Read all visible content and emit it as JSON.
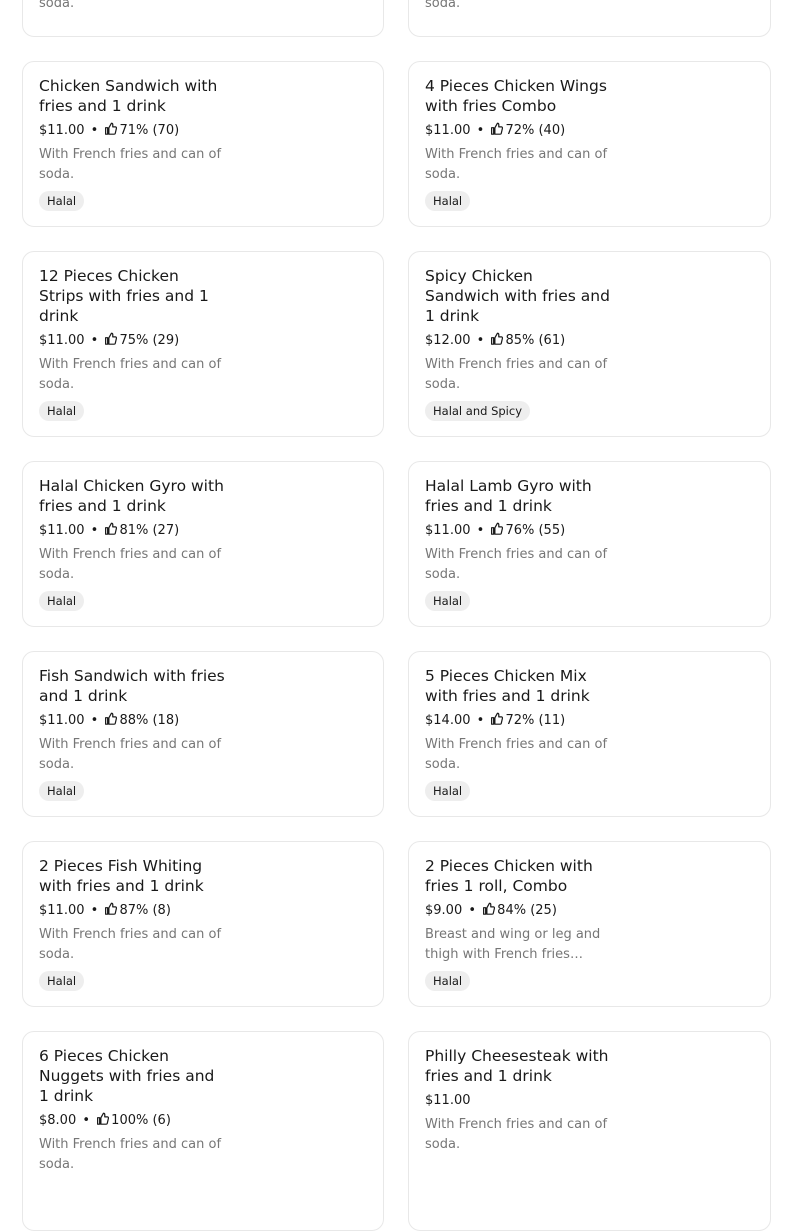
{
  "top_partial": {
    "left": {
      "description": "soda."
    },
    "right": {
      "description": "soda."
    }
  },
  "items": [
    {
      "title": "Chicken Sandwich with fries and 1 drink",
      "price": "$11.00",
      "rating": "71% (70)",
      "description": "With French fries and can of soda.",
      "badge": "Halal"
    },
    {
      "title": "4 Pieces Chicken Wings with fries Combo",
      "price": "$11.00",
      "rating": "72% (40)",
      "description": "With French fries and can of soda.",
      "badge": "Halal"
    },
    {
      "title": "12 Pieces Chicken Strips with fries and 1 drink",
      "price": "$11.00",
      "rating": "75% (29)",
      "description": "With French fries and can of soda.",
      "badge": "Halal"
    },
    {
      "title": "Spicy Chicken Sandwich with fries and 1 drink",
      "price": "$12.00",
      "rating": "85% (61)",
      "description": "With French fries and can of soda.",
      "badge": "Halal and Spicy"
    },
    {
      "title": "Halal Chicken Gyro with fries and 1 drink",
      "price": "$11.00",
      "rating": "81% (27)",
      "description": "With French fries and can of soda.",
      "badge": "Halal"
    },
    {
      "title": "Halal Lamb Gyro with fries and 1 drink",
      "price": "$11.00",
      "rating": "76% (55)",
      "description": "With French fries and can of soda.",
      "badge": "Halal"
    },
    {
      "title": "Fish Sandwich with fries and 1 drink",
      "price": "$11.00",
      "rating": "88% (18)",
      "description": "With French fries and can of soda.",
      "badge": "Halal"
    },
    {
      "title": "5 Pieces Chicken Mix with fries and 1 drink",
      "price": "$14.00",
      "rating": "72% (11)",
      "description": "With French fries and can of soda.",
      "badge": "Halal"
    },
    {
      "title": "2 Pieces Fish Whiting with fries and 1 drink",
      "price": "$11.00",
      "rating": "87% (8)",
      "description": "With French fries and can of soda.",
      "badge": "Halal"
    },
    {
      "title": "2 Pieces Chicken with fries 1 roll, Combo",
      "price": "$9.00",
      "rating": "84% (25)",
      "description": "Breast and wing or leg and thigh with French fries and…",
      "badge": "Halal"
    },
    {
      "title": "6 Pieces Chicken Nuggets with fries and 1 drink",
      "price": "$8.00",
      "rating": "100% (6)",
      "description": "With French fries and can of soda.",
      "badge": ""
    },
    {
      "title": "Philly Cheesesteak with fries and 1 drink",
      "price": "$11.00",
      "rating": "",
      "description": "With French fries and can of soda.",
      "badge": ""
    }
  ],
  "meta_separator": "•",
  "icons": {
    "rating": "thumbs-up-icon"
  },
  "colors": {
    "text": "#191919",
    "muted": "#767676",
    "border": "#e8e8e8",
    "badge_bg": "#eeeeee"
  }
}
